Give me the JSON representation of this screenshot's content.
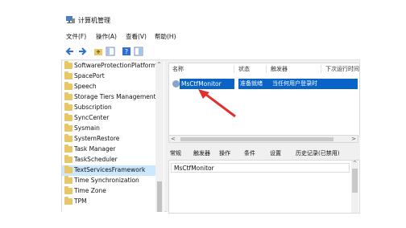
{
  "window": {
    "title": "计算机管理"
  },
  "menu": [
    "文件(F)",
    "操作(A)",
    "查看(V)",
    "帮助(H)"
  ],
  "toolbar": {
    "buttons": [
      "back-icon",
      "forward-icon",
      "folder-up-icon",
      "console-tree-icon",
      "help-icon",
      "panel-icon"
    ]
  },
  "tree": {
    "items": [
      "SoftwareProtectionPlatform",
      "SpacePort",
      "Speech",
      "Storage Tiers Management",
      "Subscription",
      "SyncCenter",
      "Sysmain",
      "SystemRestore",
      "Task Manager",
      "TaskScheduler",
      "TextServicesFramework",
      "Time Synchronization",
      "Time Zone",
      "TPM"
    ],
    "selected_index": 10
  },
  "task_list": {
    "columns": [
      "名称",
      "状态",
      "触发器",
      "下次运行时间"
    ],
    "rows": [
      {
        "name": "MsCtfMonitor",
        "status": "准备就绪",
        "trigger": "当任何用户登录时"
      }
    ]
  },
  "detail": {
    "tabs": [
      "常规",
      "触发器",
      "操作",
      "条件",
      "设置",
      "历史记录(已禁用)"
    ],
    "name_value": "MsCtfMonitor"
  },
  "colors": {
    "selection": "#0a64c8",
    "tree_selection": "#cce8ff",
    "annotation_arrow": "#e03030"
  }
}
